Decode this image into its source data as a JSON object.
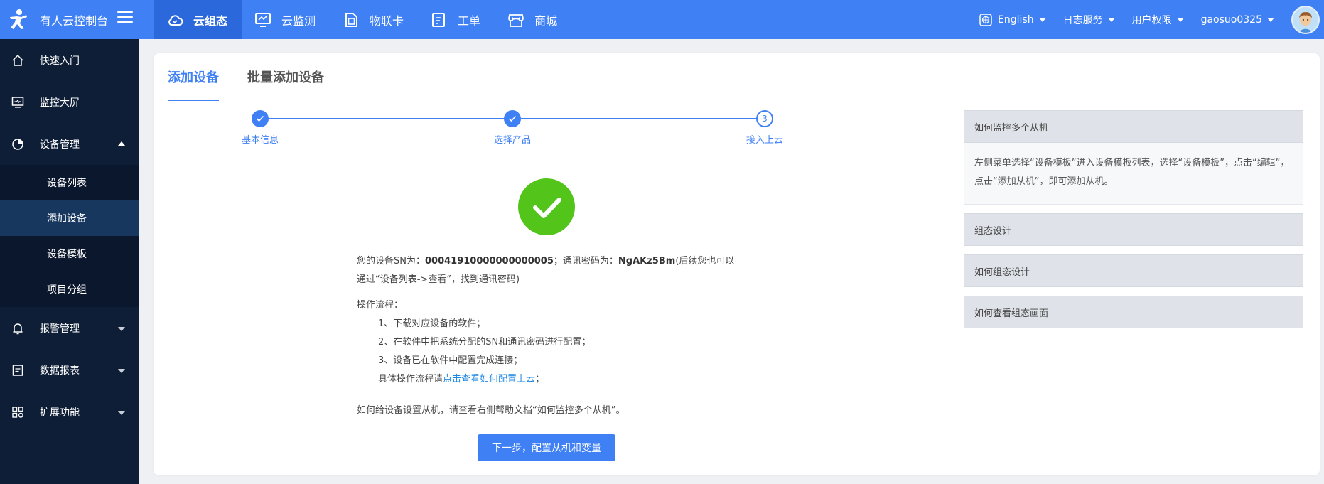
{
  "app": {
    "title": "有人云控制台"
  },
  "nav": {
    "tabs": [
      {
        "label": "云组态",
        "icon": "cloud-icon"
      },
      {
        "label": "云监测",
        "icon": "monitor-icon"
      },
      {
        "label": "物联卡",
        "icon": "sim-card-icon"
      },
      {
        "label": "工单",
        "icon": "ticket-icon"
      },
      {
        "label": "商城",
        "icon": "store-icon"
      }
    ],
    "right": {
      "language": "English",
      "log": "日志服务",
      "permissions": "用户权限",
      "user": "gaosuo0325"
    }
  },
  "sidebar": {
    "items": [
      {
        "label": "快速入门",
        "icon": "home-icon"
      },
      {
        "label": "监控大屏",
        "icon": "screen-icon"
      },
      {
        "label": "设备管理",
        "icon": "device-icon",
        "expanded": true
      },
      {
        "label": "报警管理",
        "icon": "bell-icon"
      },
      {
        "label": "数据报表",
        "icon": "report-icon"
      },
      {
        "label": "扩展功能",
        "icon": "extend-icon"
      }
    ],
    "subitems": [
      {
        "label": "设备列表"
      },
      {
        "label": "添加设备",
        "active": true
      },
      {
        "label": "设备模板"
      },
      {
        "label": "项目分组"
      }
    ]
  },
  "page": {
    "tabs": [
      "添加设备",
      "批量添加设备"
    ],
    "steps": [
      {
        "label": "基本信息",
        "status": "done"
      },
      {
        "label": "选择产品",
        "status": "done"
      },
      {
        "label": "接入上云",
        "status": "current",
        "number": "3"
      }
    ],
    "info": {
      "sn_prefix": "您的设备SN为：",
      "sn": "00041910000000000005",
      "pwd_prefix": "；通讯密码为：",
      "pwd": "NgAKz5Bm",
      "pwd_suffix": "(后续您也可以",
      "line2": "通过“设备列表->查看”，找到通讯密码)",
      "flow_title": "操作流程：",
      "step1": "1、下载对应设备的软件；",
      "step2": "2、在软件中把系统分配的SN和通讯密码进行配置；",
      "step3": "3、设备已在软件中配置完成连接；",
      "detail_prefix": "具体操作流程请",
      "detail_link": "点击查看如何配置上云",
      "detail_suffix": "；",
      "slave_hint": "如何给设备设置从机，请查看右侧帮助文档“如何监控多个从机”。"
    },
    "next_button": "下一步，配置从机和变量"
  },
  "help": {
    "items": [
      {
        "title": "如何监控多个从机",
        "body": "左侧菜单选择“设备模板”进入设备模板列表，选择“设备模板”，点击“编辑”，点击“添加从机”，即可添加从机。"
      },
      {
        "title": "组态设计"
      },
      {
        "title": "如何组态设计"
      },
      {
        "title": "如何查看组态画面"
      }
    ]
  },
  "colors": {
    "primary": "#3f80f5",
    "sidebar": "#0e1e37",
    "success": "#52c41a",
    "link": "#1e88e5"
  }
}
